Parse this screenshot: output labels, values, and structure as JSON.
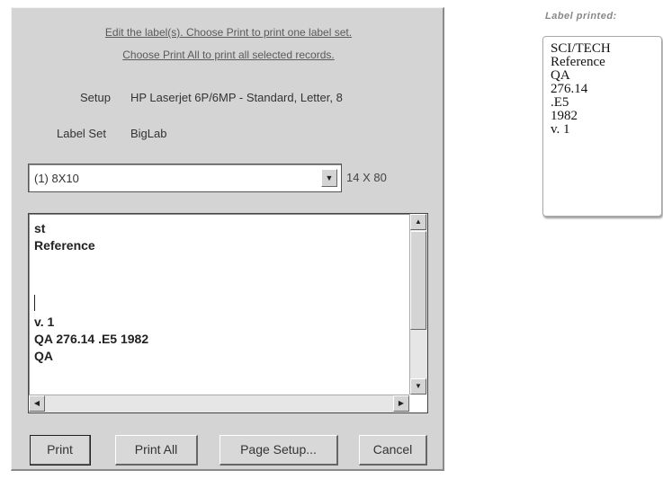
{
  "dialog": {
    "instruction_1": "Edit the label(s). Choose Print to print one label set.",
    "instruction_2": "Choose Print All to print all selected records.",
    "setup_label": "Setup",
    "setup_value": "HP Laserjet 6P/6MP - Standard, Letter, 8",
    "labelset_label": "Label Set",
    "labelset_value": "BigLab",
    "format_select": "(1) 8X10",
    "dimensions": "14  X  80",
    "editor_lines": [
      "st",
      "Reference",
      "",
      "",
      "",
      "v. 1",
      "QA 276.14 .E5 1982",
      "QA"
    ],
    "buttons": {
      "print": "Print",
      "print_all": "Print All",
      "page_setup": "Page Setup...",
      "cancel": "Cancel"
    }
  },
  "label_printed": {
    "title": "Label printed:",
    "lines": [
      "SCI/TECH",
      "Reference",
      "QA",
      "276.14",
      ".E5",
      "1982",
      "v. 1"
    ]
  },
  "icons": {
    "combo_arrow": "chevron-down-icon",
    "scroll_up": "arrow-up-icon",
    "scroll_down": "arrow-down-icon",
    "scroll_left": "arrow-left-icon",
    "scroll_right": "arrow-right-icon"
  }
}
